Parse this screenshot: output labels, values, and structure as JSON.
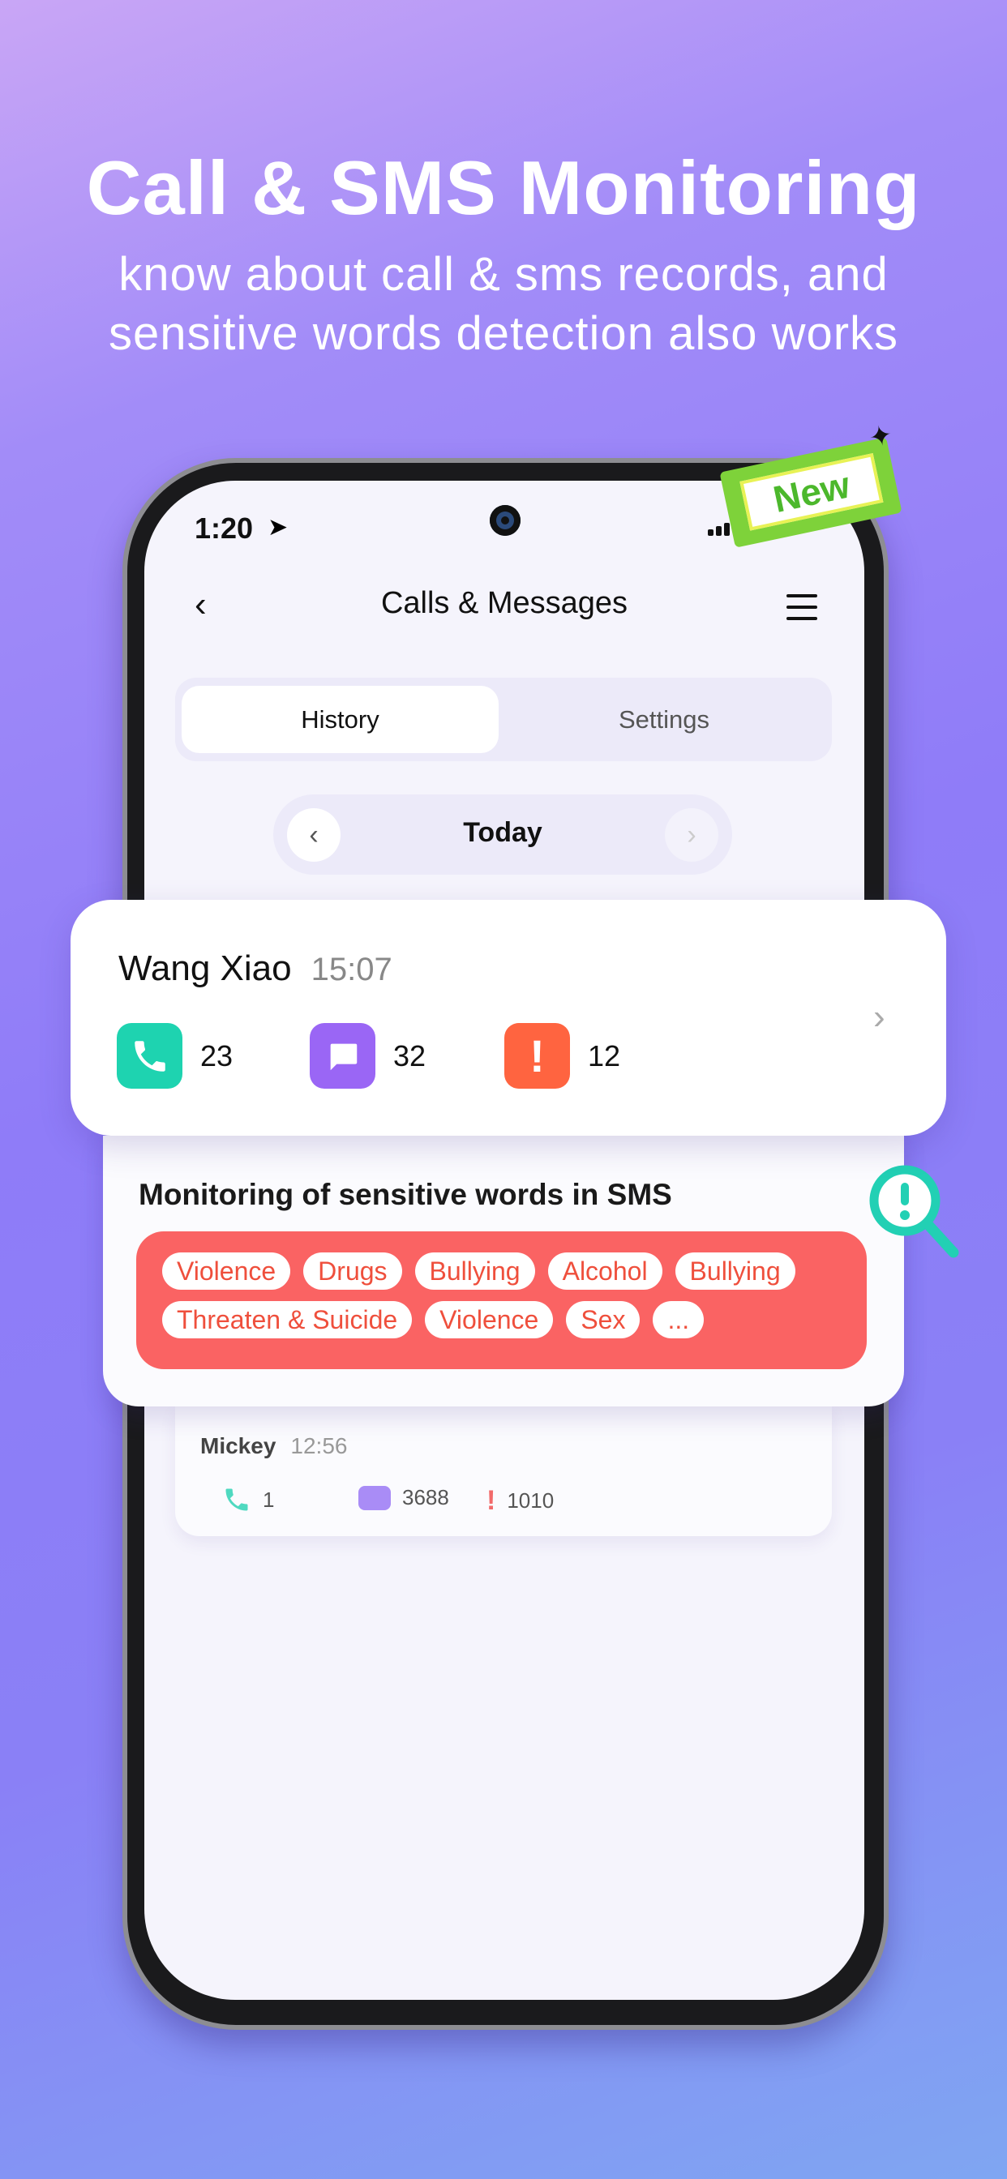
{
  "promo": {
    "headline": "Call & SMS Monitoring",
    "subtitle_line1": "know about call & sms records, and",
    "subtitle_line2": "sensitive words detection also works",
    "badge": "New"
  },
  "status_bar": {
    "time": "1:20"
  },
  "header": {
    "title": "Calls & Messages",
    "back_icon": "chevron-left-icon",
    "menu_icon": "hamburger-icon"
  },
  "tabs": [
    {
      "label": "History",
      "active": true
    },
    {
      "label": "Settings",
      "active": false
    }
  ],
  "date_nav": {
    "label": "Today"
  },
  "records": [
    {
      "name": "Wang Xiao",
      "time": "15:07",
      "calls": "23",
      "messages": "32",
      "alerts": "12"
    },
    {
      "name": "Mickey",
      "time": "12:56",
      "calls": "1",
      "messages": "3688",
      "alerts": "1010"
    }
  ],
  "sensitive": {
    "title": "Monitoring of sensitive words in SMS",
    "tags": [
      "Violence",
      "Drugs",
      "Bullying",
      "Alcohol",
      "Bullying",
      "Threaten & Suicide",
      "Violence",
      "Sex",
      "..."
    ]
  },
  "colors": {
    "call": "#1ed3b0",
    "message": "#9a66f5",
    "alert": "#ff6440",
    "tag_bg": "#fa6363"
  }
}
